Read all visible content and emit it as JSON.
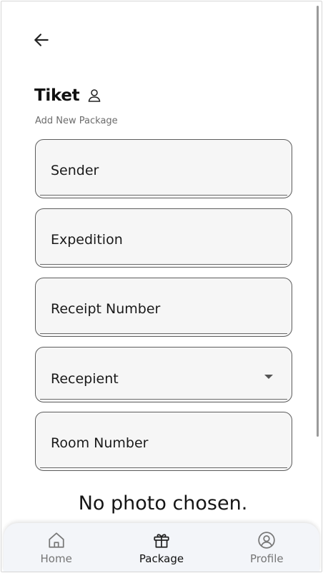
{
  "header": {
    "back_icon": "arrow-left-icon",
    "title": "Tiket",
    "title_icon": "user-icon",
    "subtitle": "Add New Package"
  },
  "form": {
    "sender_label": "Sender",
    "expedition_label": "Expedition",
    "receipt_label": "Receipt Number",
    "recipient_label": "Recepient",
    "room_label": "Room Number"
  },
  "photo": {
    "status": "No photo chosen."
  },
  "bottom_nav": {
    "items": [
      {
        "label": "Home",
        "icon": "home-icon",
        "active": false
      },
      {
        "label": "Package",
        "icon": "gift-icon",
        "active": true
      },
      {
        "label": "Profile",
        "icon": "user-circle-icon",
        "active": false
      }
    ]
  },
  "colors": {
    "field_bg": "#f6f6f6",
    "field_border": "#5c5c5c",
    "nav_bg": "#f3f5f9",
    "inactive_label": "#757575"
  }
}
